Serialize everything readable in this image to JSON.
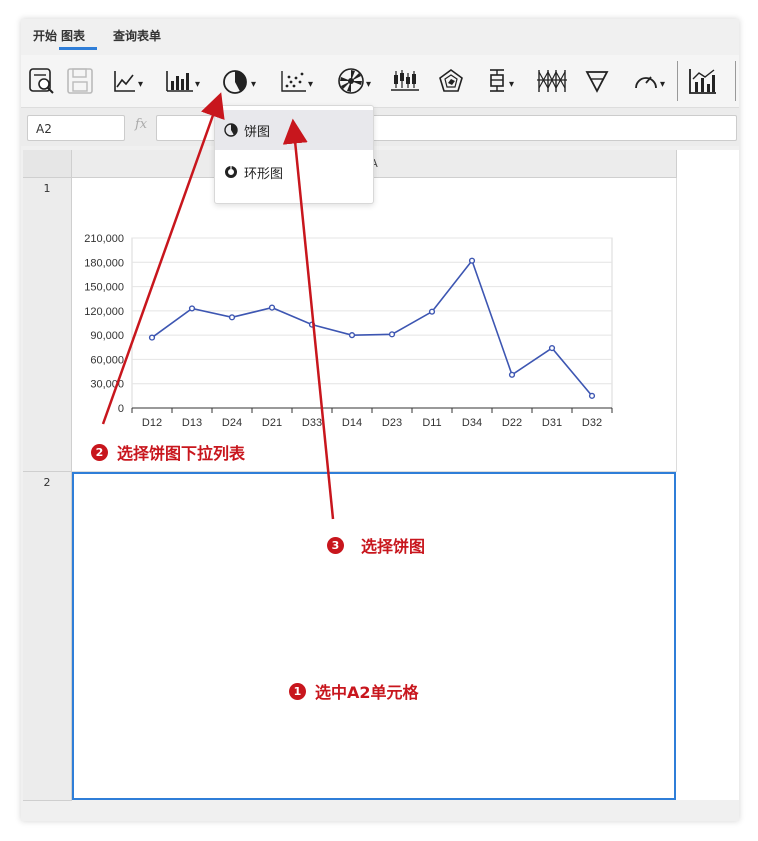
{
  "tabs": [
    {
      "label": "开始"
    },
    {
      "label": "图表"
    },
    {
      "label": "查询表单"
    }
  ],
  "active_tab": "图表",
  "toolbar": {
    "buttons": [
      {
        "icon": "preview-icon"
      },
      {
        "icon": "save-icon"
      },
      {
        "icon": "line-chart-icon",
        "dropdown": true
      },
      {
        "icon": "bar-chart-icon",
        "dropdown": true
      },
      {
        "icon": "pie-chart-icon",
        "dropdown": true
      },
      {
        "icon": "scatter-chart-icon",
        "dropdown": true
      },
      {
        "icon": "radial-chart-icon",
        "dropdown": true
      },
      {
        "icon": "candlestick-icon"
      },
      {
        "icon": "radar-chart-icon"
      },
      {
        "icon": "boxplot-icon",
        "dropdown": true
      },
      {
        "icon": "grid-chart-icon"
      },
      {
        "icon": "funnel-chart-icon"
      },
      {
        "icon": "gauge-chart-icon",
        "dropdown": true
      },
      {
        "icon": "combo-chart-icon"
      }
    ]
  },
  "formula_bar": {
    "cell_ref": "A2",
    "fx_label": "fx",
    "value": ""
  },
  "sheet": {
    "column_header": "A",
    "rows": [
      {
        "label": "1"
      },
      {
        "label": "2"
      }
    ]
  },
  "dropdown": {
    "items": [
      {
        "label": "饼图",
        "icon": "pie-chart-icon",
        "highlighted": true
      },
      {
        "label": "环形图",
        "icon": "donut-chart-icon",
        "highlighted": false
      }
    ]
  },
  "annotations": [
    {
      "number": "1",
      "text": "选中A2单元格"
    },
    {
      "number": "2",
      "text": "选择饼图下拉列表"
    },
    {
      "number": "3",
      "text": "选择饼图"
    }
  ],
  "colors": {
    "accent": "#2f7ed8",
    "annotation": "#c8161d",
    "series_line": "#3d56b2"
  },
  "chart_data": {
    "type": "line",
    "categories": [
      "D12",
      "D13",
      "D24",
      "D21",
      "D33",
      "D14",
      "D23",
      "D11",
      "D34",
      "D22",
      "D31",
      "D32"
    ],
    "series": [
      {
        "values": [
          87000,
          123000,
          112000,
          124000,
          103000,
          90000,
          91000,
          119000,
          182000,
          41000,
          74000,
          15000
        ]
      }
    ],
    "yticks": [
      "0",
      "30,000",
      "60,000",
      "90,000",
      "120,000",
      "150,000",
      "180,000",
      "210,000"
    ],
    "ylim": [
      0,
      210000
    ],
    "title": "",
    "xlabel": "",
    "ylabel": "",
    "grid": true
  }
}
